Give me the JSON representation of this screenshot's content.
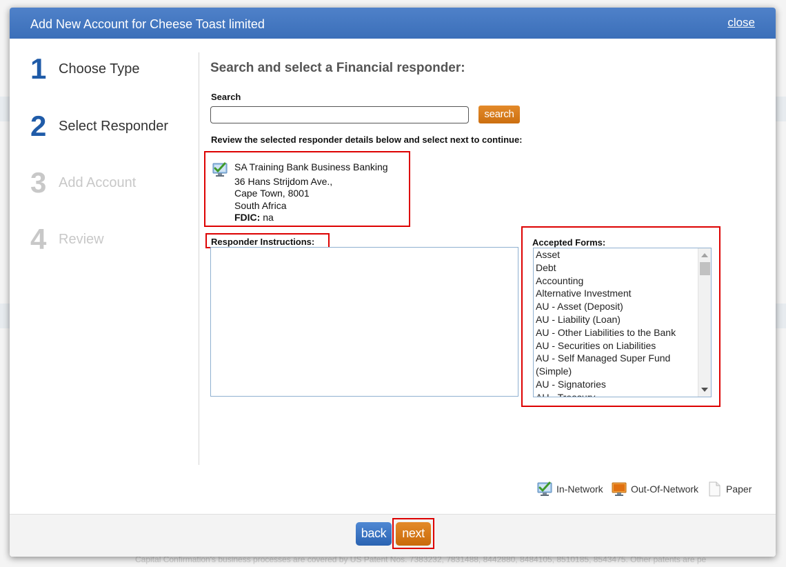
{
  "background": {
    "footer_text": "Capital Confirmation's business processes are covered by US Patent Nos. 7383232, 7831488, 8442880, 8484105, 8510185, 8543475. Other patents are pe"
  },
  "modal": {
    "title": "Add New Account for Cheese Toast limited",
    "close_label": "close"
  },
  "steps": [
    {
      "number": "1",
      "label": "Choose Type",
      "state": "completed"
    },
    {
      "number": "2",
      "label": "Select Responder",
      "state": "active"
    },
    {
      "number": "3",
      "label": "Add Account",
      "state": "inactive"
    },
    {
      "number": "4",
      "label": "Review",
      "state": "inactive"
    }
  ],
  "main": {
    "title": "Search and select a Financial responder:",
    "search_label": "Search",
    "search_value": "",
    "search_button": "search",
    "review_text": "Review the selected responder details below and select next to continue:"
  },
  "responder": {
    "name": "SA Training Bank Business Banking",
    "address1": "36 Hans Strijdom Ave.,",
    "address2": "Cape Town, 8001",
    "country": "South Africa",
    "fdic_label": "FDIC:",
    "fdic_value": "na",
    "network_icon": "in-network-icon"
  },
  "instructions": {
    "label": "Responder Instructions:",
    "text": ""
  },
  "accepted_forms": {
    "label": "Accepted Forms:",
    "items": [
      "Asset",
      "Debt",
      "Accounting",
      "Alternative Investment",
      "AU - Asset (Deposit)",
      "AU - Liability (Loan)",
      "AU - Other Liabilities to the Bank",
      "AU - Securities on Liabilities",
      "AU - Self Managed Super Fund (Simple)",
      "AU - Signatories",
      "AU - Treasury"
    ]
  },
  "legend": {
    "in_network": "In-Network",
    "out_of_network": "Out-Of-Network",
    "paper": "Paper"
  },
  "footer": {
    "back_label": "back",
    "next_label": "next"
  },
  "colors": {
    "header_blue": "#3b6fb9",
    "step_blue": "#1f5ba8",
    "orange_button": "#cc6f10",
    "highlight_red": "#dd0000"
  }
}
